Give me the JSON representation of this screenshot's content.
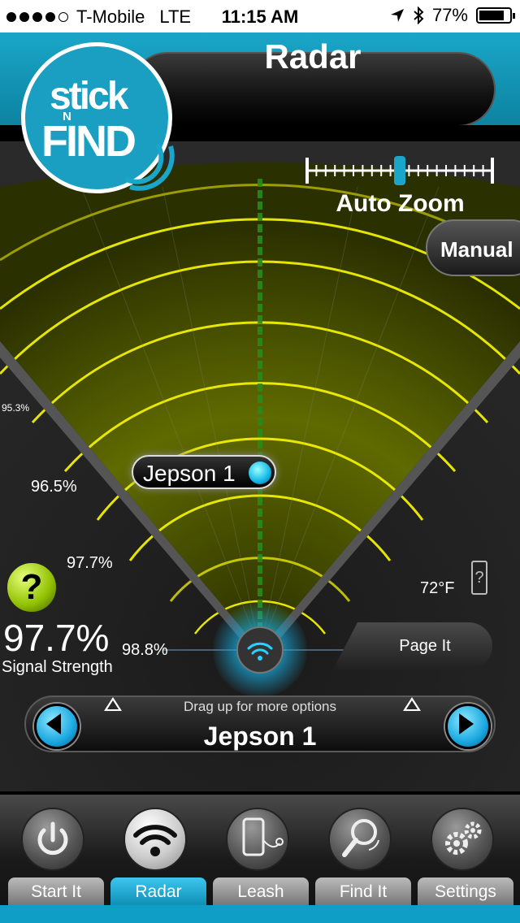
{
  "status_bar": {
    "carrier": "T-Mobile",
    "network": "LTE",
    "time": "11:15 AM",
    "battery": "77%",
    "signal_bars_filled": 4,
    "signal_bars_total": 5
  },
  "header": {
    "title": "Radar",
    "logo": {
      "top": "stick",
      "mid": "N",
      "bottom": "FIND"
    }
  },
  "zoom": {
    "label": "Auto Zoom",
    "manual_button": "Manual",
    "slider_level": 0.5
  },
  "radar": {
    "percent_labels": [
      "95.3%",
      "96.5%",
      "97.7%",
      "98.8%"
    ],
    "device_tag": "Jepson 1",
    "temperature": "72°F",
    "battery_icon": "?"
  },
  "signal": {
    "value": "97.7%",
    "label": "Signal Strength",
    "help": "?"
  },
  "page_button": "Page It",
  "selector": {
    "hint": "Drag up for more options",
    "device_name": "Jepson 1"
  },
  "tabs": [
    {
      "label": "Start It",
      "icon": "power-icon",
      "active": false
    },
    {
      "label": "Radar",
      "icon": "wifi-icon",
      "active": true
    },
    {
      "label": "Leash",
      "icon": "phone-leash-icon",
      "active": false
    },
    {
      "label": "Find It",
      "icon": "magnifier-icon",
      "active": false
    },
    {
      "label": "Settings",
      "icon": "gears-icon",
      "active": false
    }
  ],
  "colors": {
    "accent": "#1aa6c8",
    "radar_ring": "#e8e80a",
    "active_tab": "#1eb0dc"
  }
}
